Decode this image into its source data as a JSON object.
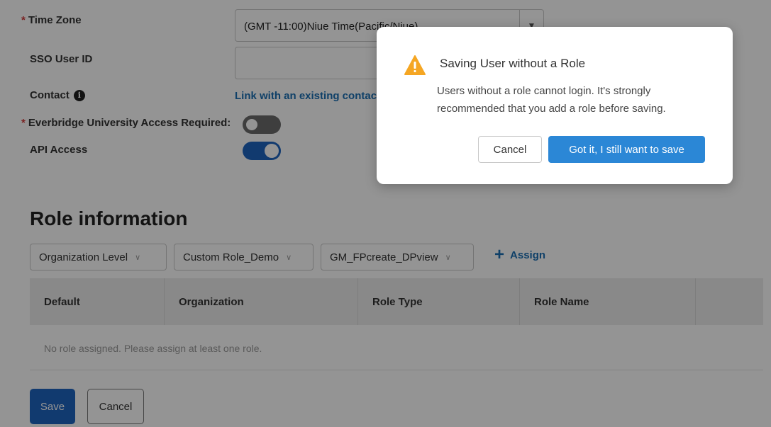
{
  "form": {
    "time_zone": {
      "required_mark": "*",
      "label": "Time Zone",
      "value": "(GMT -11:00)Niue Time(Pacific/Niue)"
    },
    "sso_user_id": {
      "label": "SSO User ID",
      "value": ""
    },
    "contact": {
      "label": "Contact",
      "info_icon": "info-icon",
      "link": "Link with an existing contact"
    },
    "eu_access": {
      "required_mark": "*",
      "label": "Everbridge University Access Required:",
      "enabled": false
    },
    "api_access": {
      "label": "API Access",
      "enabled": true
    }
  },
  "role_info": {
    "title": "Role information",
    "dropdowns": [
      {
        "value": "Organization Level"
      },
      {
        "value": "Custom Role_Demo"
      },
      {
        "value": "GM_FPcreate_DPview"
      }
    ],
    "assign_label": "Assign",
    "table": {
      "columns": [
        "Default",
        "Organization",
        "Role Type",
        "Role Name",
        ""
      ],
      "empty_message": "No role assigned. Please assign at least one role."
    }
  },
  "footer": {
    "save_label": "Save",
    "cancel_label": "Cancel"
  },
  "dialog": {
    "title": "Saving User without a Role",
    "body": "Users without a role cannot login. It's strongly recommended that you add a role before saving.",
    "cancel_label": "Cancel",
    "confirm_label": "Got it, I still want to save",
    "icon": "warning-icon",
    "colors": {
      "primary": "#2b87d6",
      "warning": "#f5a623",
      "link": "#1b6fb3"
    }
  }
}
